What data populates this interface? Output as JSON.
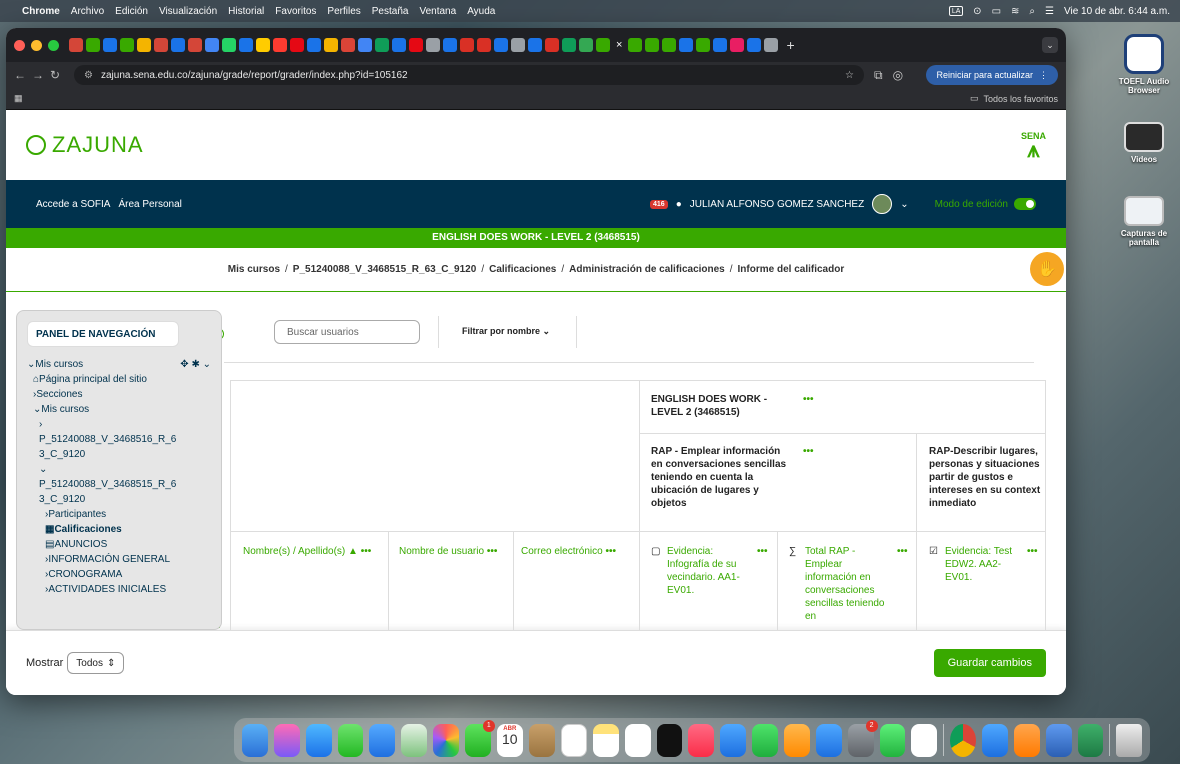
{
  "menubar": {
    "app": "Chrome",
    "items": [
      "Archivo",
      "Edición",
      "Visualización",
      "Historial",
      "Favoritos",
      "Perfiles",
      "Pestaña",
      "Ventana",
      "Ayuda"
    ],
    "clock": "Vie 10 de abr.  6:44 a.m."
  },
  "desktop": {
    "icons": [
      {
        "label": "TOEFL Audio Browser"
      },
      {
        "label": "Videos"
      },
      {
        "label": "Capturas de pantalla"
      }
    ]
  },
  "browser": {
    "url": "zajuna.sena.edu.co/zajuna/grade/report/grader/index.php?id=105162",
    "update_label": "Reiniciar para actualizar",
    "all_bookmarks": "Todos los favoritos"
  },
  "site": {
    "logo_text": "ZAJUNA",
    "sena_label": "SENA"
  },
  "topnav": {
    "link1": "Accede a SOFIA",
    "link2": "Área Personal",
    "notif_count": "416",
    "user_name": "JULIAN ALFONSO GOMEZ SANCHEZ",
    "edit_mode": "Modo de edición"
  },
  "course_title": "ENGLISH DOES WORK - LEVEL 2 (3468515)",
  "breadcrumb": {
    "items": [
      "Mis cursos",
      "P_51240088_V_3468515_R_63_C_9120",
      "Calificaciones",
      "Administración de calificaciones",
      "Informe del calificador"
    ]
  },
  "sidebar": {
    "title": "PANEL DE NAVEGACIÓN",
    "mis_cursos": "Mis cursos",
    "home": "Página principal del sitio",
    "secciones": "Secciones",
    "mis_cursos2": "Mis cursos",
    "course1": "P_51240088_V_3468516_R_6 3_C_9120",
    "course2": "P_51240088_V_3468515_R_6 3_C_9120",
    "participantes": "Participantes",
    "calificaciones": "Calificaciones",
    "anuncios": "ANUNCIOS",
    "info_general": "INFORMACIÓN GENERAL",
    "cronograma": "CRONOGRAMA",
    "actividades": "ACTIVIDADES INICIALES"
  },
  "filters": {
    "search_placeholder": "Buscar usuarios",
    "filter_by_name": "Filtrar por nombre"
  },
  "grader": {
    "course_header": "ENGLISH DOES WORK - LEVEL 2 (3468515)",
    "rap1": "RAP - Emplear información en conversaciones sencillas teniendo en cuenta la ubicación de lugares y objetos",
    "rap2": "RAP-Describir lugares, personas y situaciones partir de gustos e intereses en su context inmediato",
    "col_name": "Nombre(s) / Apellido(s)",
    "col_username": "Nombre de usuario",
    "col_email": "Correo electrónico",
    "col_ev1": "Evidencia: Infografía de su vecindario. AA1-EV01.",
    "col_total": "Total RAP - Emplear información en conversaciones sencillas teniendo en",
    "col_ev2": "Evidencia: Test EDW2. AA2-EV01.",
    "dots": "•••"
  },
  "footer": {
    "show_label": "Mostrar",
    "show_value": "Todos",
    "save_label": "Guardar cambios"
  },
  "dock": {
    "calendar_month": "ABR",
    "calendar_day": "10",
    "facetime_badge": "1",
    "settings_badge": "2"
  },
  "colors": {
    "sena_green": "#39a900",
    "nav_blue": "#00324d"
  }
}
